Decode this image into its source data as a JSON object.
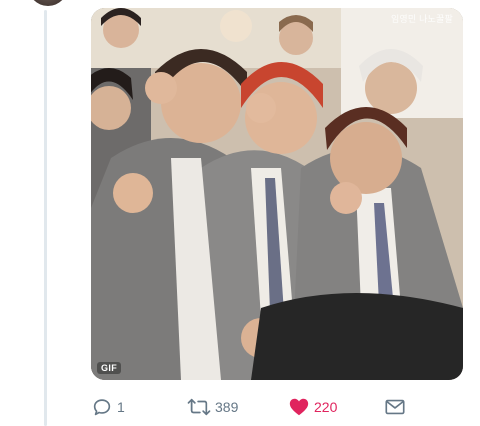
{
  "tweet": {
    "media": {
      "watermark": "임영민 나노꿀팔",
      "badge": "GIF"
    },
    "actions": {
      "reply": {
        "icon": "reply-icon",
        "count": "1"
      },
      "retweet": {
        "icon": "retweet-icon",
        "count": "389"
      },
      "like": {
        "icon": "heart-icon",
        "count": "220",
        "active": true,
        "color": "#e0245e"
      },
      "dm": {
        "icon": "envelope-icon"
      }
    }
  },
  "colors": {
    "action_gray": "#657786",
    "like_red": "#e0245e",
    "thread_line": "#e1e8ed"
  }
}
